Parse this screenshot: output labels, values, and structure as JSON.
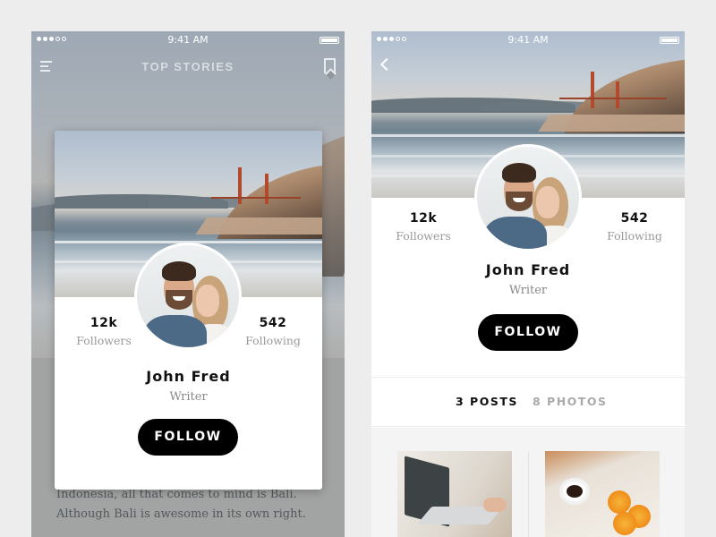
{
  "status_bar": {
    "time": "9:41 AM"
  },
  "left_screen": {
    "nav_title": "TOP STORIES",
    "article_text": "Indonesia, all that comes to mind is Bali. Although Bali is awesome in its own right."
  },
  "profile": {
    "name": "John Fred",
    "role": "Writer",
    "followers_count": "12k",
    "followers_label": "Followers",
    "following_count": "542",
    "following_label": "Following",
    "follow_label": "FOLLOW"
  },
  "right_screen": {
    "tabs": [
      {
        "label": "3  POSTS",
        "active": true
      },
      {
        "label": "8  PHOTOS",
        "active": false
      }
    ]
  },
  "colors": {
    "accent": "#000000",
    "background": "#ededed",
    "muted_text": "#999999"
  },
  "icons": [
    "menu-icon",
    "bookmark-icon",
    "back-icon",
    "battery-icon",
    "signal-icon"
  ]
}
